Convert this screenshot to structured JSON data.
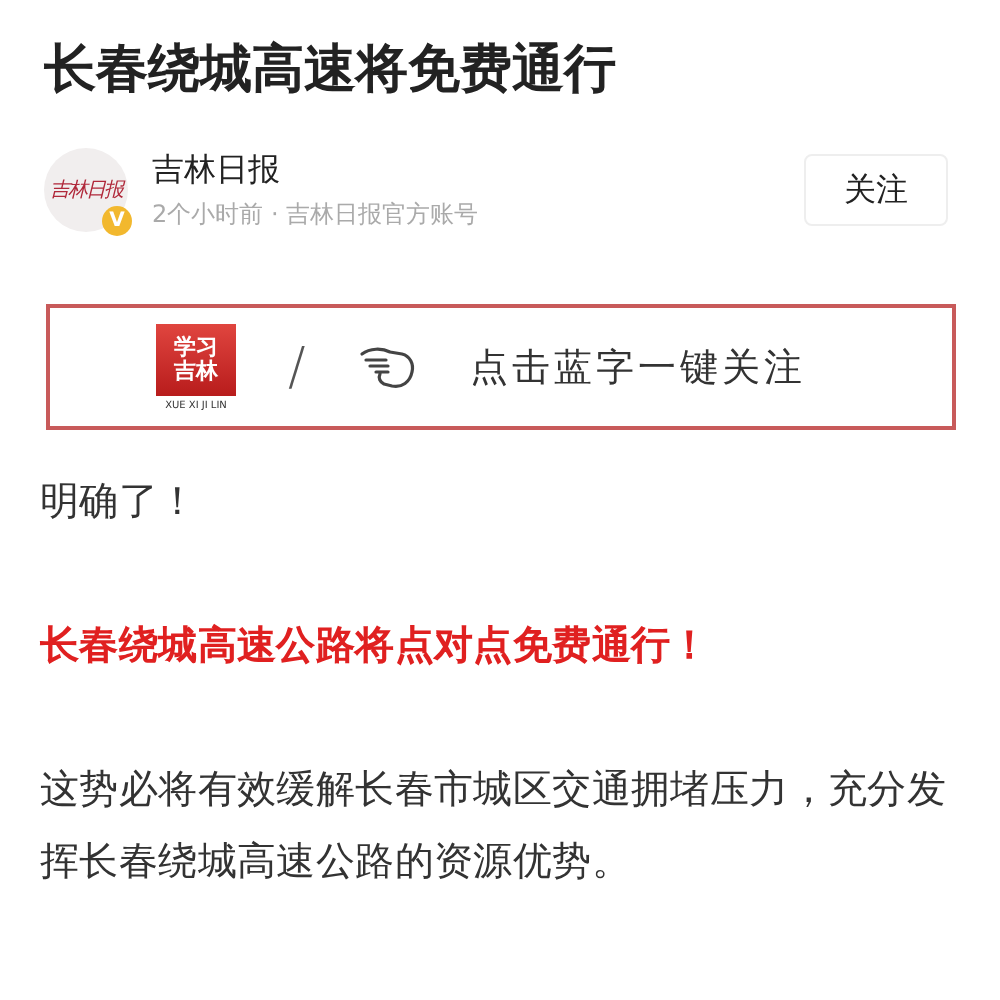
{
  "article": {
    "title": "长春绕城高速将免费通行"
  },
  "author": {
    "avatar_logo": "吉林日报",
    "verified_badge": "V",
    "name": "吉林日报",
    "meta": "2个小时前 · 吉林日报官方账号",
    "follow_button": "关注"
  },
  "banner": {
    "logo_line_1": "学习",
    "logo_line_2": "吉林",
    "logo_pinyin": "XUE XI JI LIN",
    "separator": "/",
    "prompt": "点击蓝字一键关注"
  },
  "paragraphs": [
    {
      "kind": "plain",
      "text": "明确了！"
    },
    {
      "kind": "emphasis",
      "text": "长春绕城高速公路将点对点免费通行！"
    },
    {
      "kind": "plain",
      "text": "这势必将有效缓解长春市城区交通拥堵压力，充分发挥长春绕城高速公路的资源优势。"
    }
  ]
}
